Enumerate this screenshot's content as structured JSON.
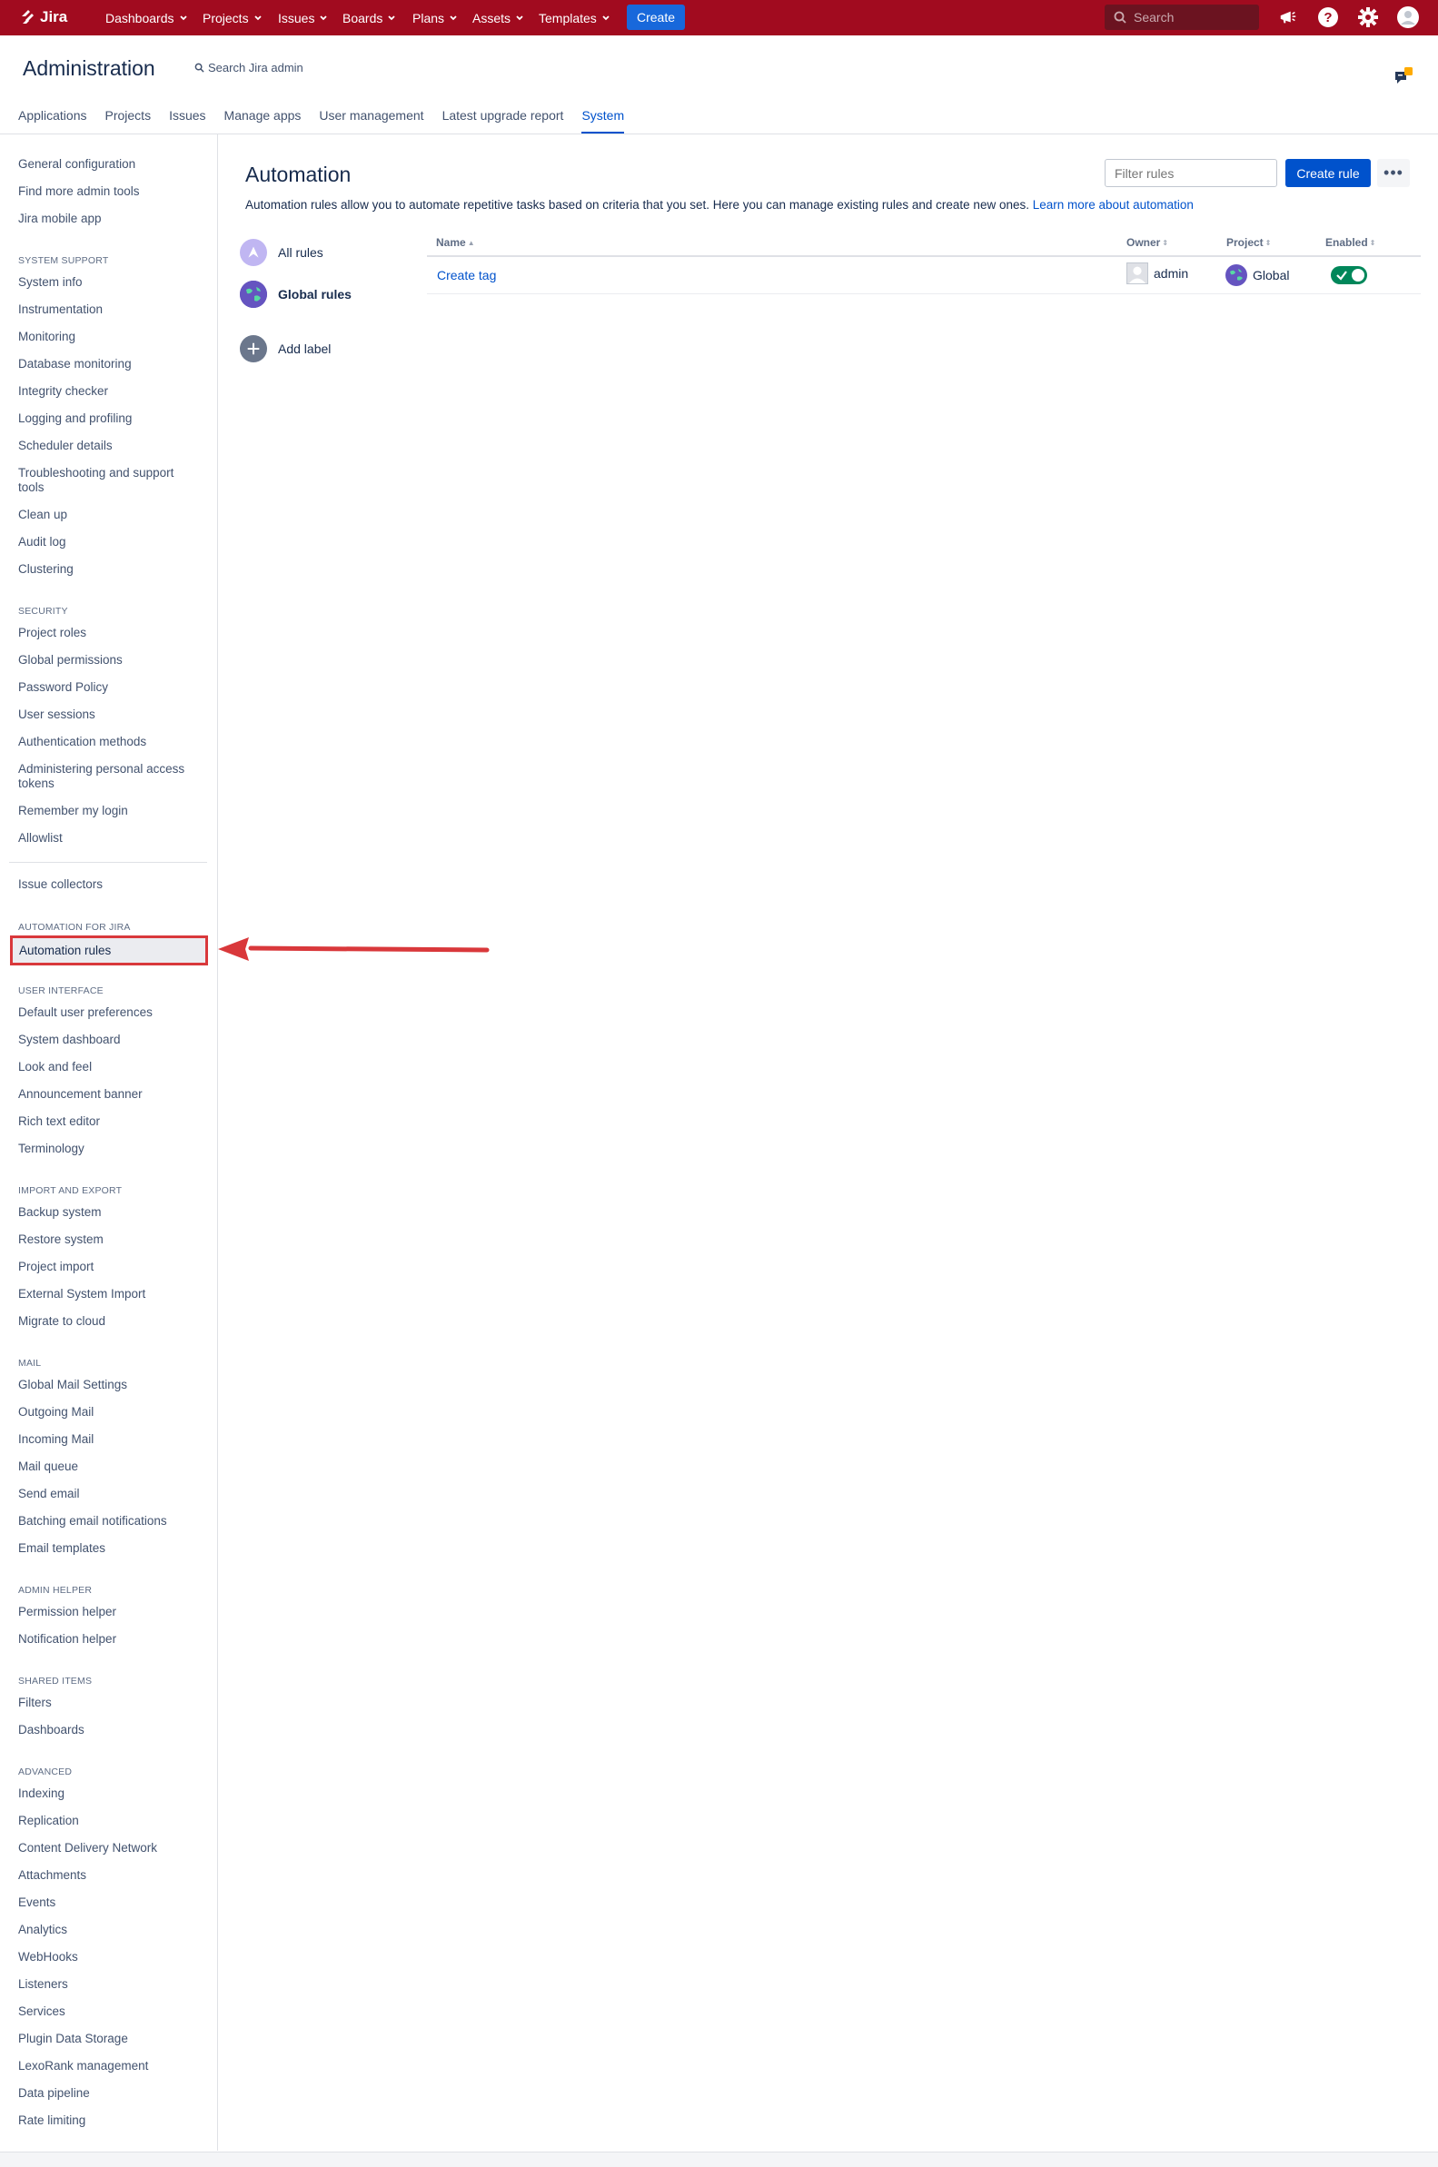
{
  "topbar": {
    "brand": "Jira",
    "nav": [
      "Dashboards",
      "Projects",
      "Issues",
      "Boards",
      "Plans",
      "Assets",
      "Templates"
    ],
    "create_label": "Create",
    "search_placeholder": "Search",
    "icons": [
      "notifications-icon",
      "help-icon",
      "settings-icon",
      "avatar"
    ]
  },
  "admin": {
    "title": "Administration",
    "search_label": "Search Jira admin",
    "tabs": [
      "Applications",
      "Projects",
      "Issues",
      "Manage apps",
      "User management",
      "Latest upgrade report",
      "System"
    ],
    "active_tab": "System"
  },
  "sidebar": {
    "top": [
      "General configuration",
      "Find more admin tools",
      "Jira mobile app"
    ],
    "system_support": {
      "heading": "SYSTEM SUPPORT",
      "items": [
        "System info",
        "Instrumentation",
        "Monitoring",
        "Database monitoring",
        "Integrity checker",
        "Logging and profiling",
        "Scheduler details",
        "Troubleshooting and support tools",
        "Clean up",
        "Audit log",
        "Clustering"
      ]
    },
    "security": {
      "heading": "SECURITY",
      "items": [
        "Project roles",
        "Global permissions",
        "Password Policy",
        "User sessions",
        "Authentication methods",
        "Administering personal access tokens",
        "Remember my login",
        "Allowlist"
      ]
    },
    "issue_collectors": "Issue collectors",
    "automation": {
      "heading": "AUTOMATION FOR JIRA",
      "active_item": "Automation rules"
    },
    "user_interface": {
      "heading": "USER INTERFACE",
      "items": [
        "Default user preferences",
        "System dashboard",
        "Look and feel",
        "Announcement banner",
        "Rich text editor",
        "Terminology"
      ]
    },
    "import_export": {
      "heading": "IMPORT AND EXPORT",
      "items": [
        "Backup system",
        "Restore system",
        "Project import",
        "External System Import",
        "Migrate to cloud"
      ]
    },
    "mail": {
      "heading": "MAIL",
      "items": [
        "Global Mail Settings",
        "Outgoing Mail",
        "Incoming Mail",
        "Mail queue",
        "Send email",
        "Batching email notifications",
        "Email templates"
      ]
    },
    "admin_helper": {
      "heading": "ADMIN HELPER",
      "items": [
        "Permission helper",
        "Notification helper"
      ]
    },
    "shared_items": {
      "heading": "SHARED ITEMS",
      "items": [
        "Filters",
        "Dashboards"
      ]
    },
    "advanced": {
      "heading": "ADVANCED",
      "items": [
        "Indexing",
        "Replication",
        "Content Delivery Network",
        "Attachments",
        "Events",
        "Analytics",
        "WebHooks",
        "Listeners",
        "Services",
        "Plugin Data Storage",
        "LexoRank management",
        "Data pipeline",
        "Rate limiting"
      ]
    }
  },
  "main": {
    "title": "Automation",
    "filter_placeholder": "Filter rules",
    "create_rule_label": "Create rule",
    "more_label": "•••",
    "description": "Automation rules allow you to automate repetitive tasks based on criteria that you set. Here you can manage existing rules and create new ones.",
    "learn_more": "Learn more about automation",
    "labels": [
      "All rules",
      "Global rules",
      "Add label"
    ],
    "columns": [
      "Name",
      "Owner",
      "Project",
      "Enabled"
    ],
    "rows": [
      {
        "name": "Create tag",
        "owner": "admin",
        "project": "Global",
        "enabled": true
      }
    ]
  }
}
